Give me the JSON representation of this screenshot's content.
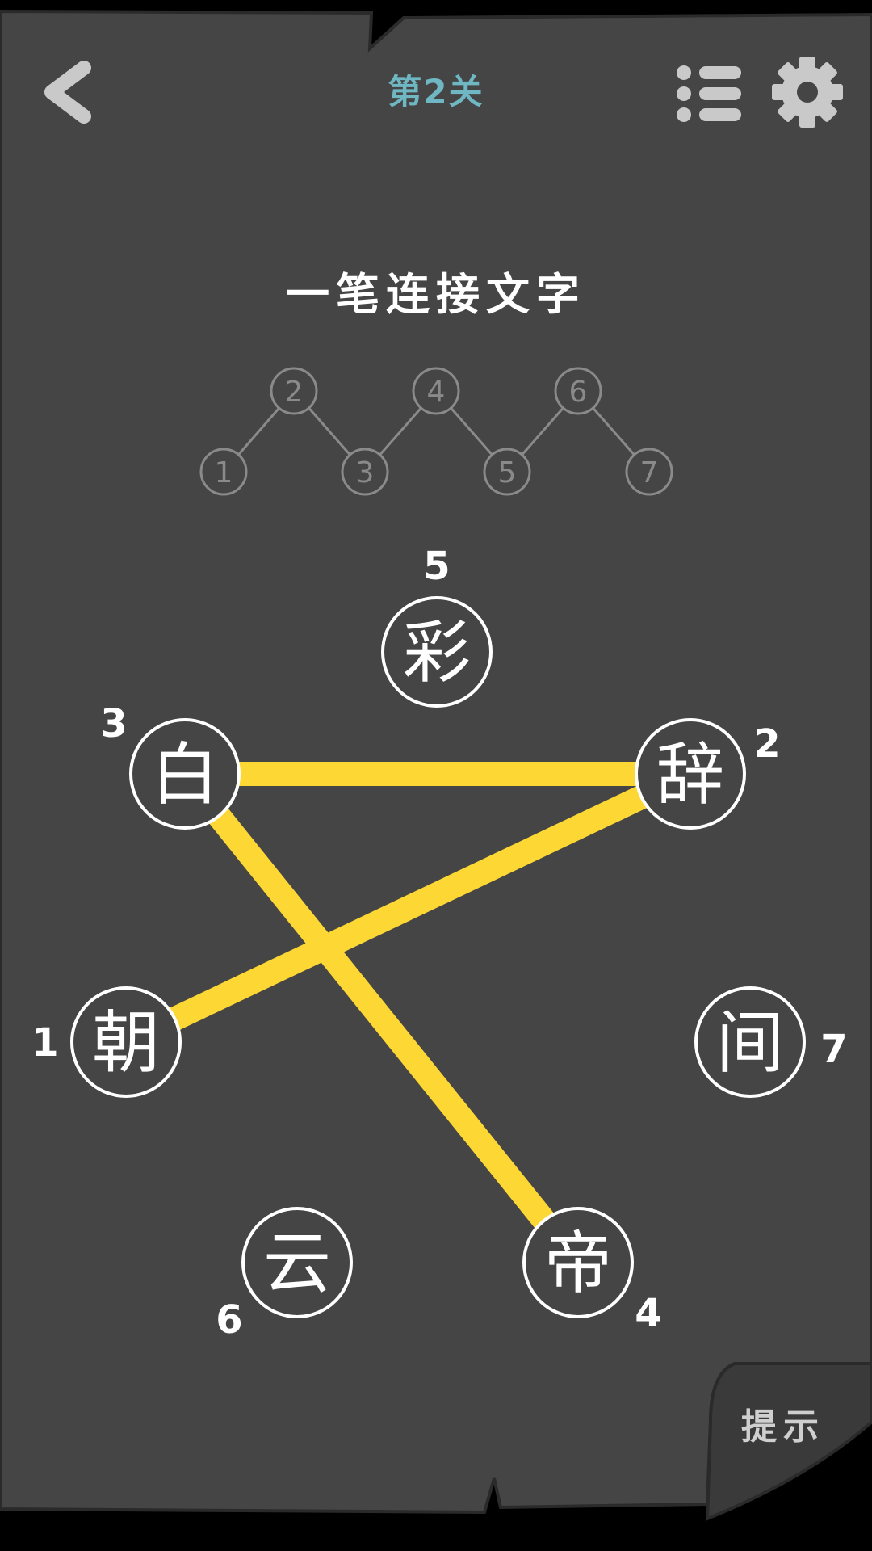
{
  "header": {
    "level_title": "第2关",
    "icons": {
      "back": "chevron-left-icon",
      "list": "list-icon",
      "settings": "gear-icon"
    }
  },
  "instruction": "一笔连接文字",
  "diagram_nodes": [
    "1",
    "2",
    "3",
    "4",
    "5",
    "6",
    "7"
  ],
  "characters": [
    {
      "char": "彩",
      "order": "5"
    },
    {
      "char": "白",
      "order": "3"
    },
    {
      "char": "辞",
      "order": "2"
    },
    {
      "char": "朝",
      "order": "1"
    },
    {
      "char": "间",
      "order": "7"
    },
    {
      "char": "云",
      "order": "6"
    },
    {
      "char": "帝",
      "order": "4"
    }
  ],
  "drawn_path": [
    "朝",
    "辞",
    "白",
    "帝"
  ],
  "hint_label": "提示",
  "colors": {
    "background": "#454545",
    "line": "#fdd835",
    "title": "#6fb7c3",
    "icon": "#c9c9c9",
    "diagram": "#8a8a8a"
  }
}
